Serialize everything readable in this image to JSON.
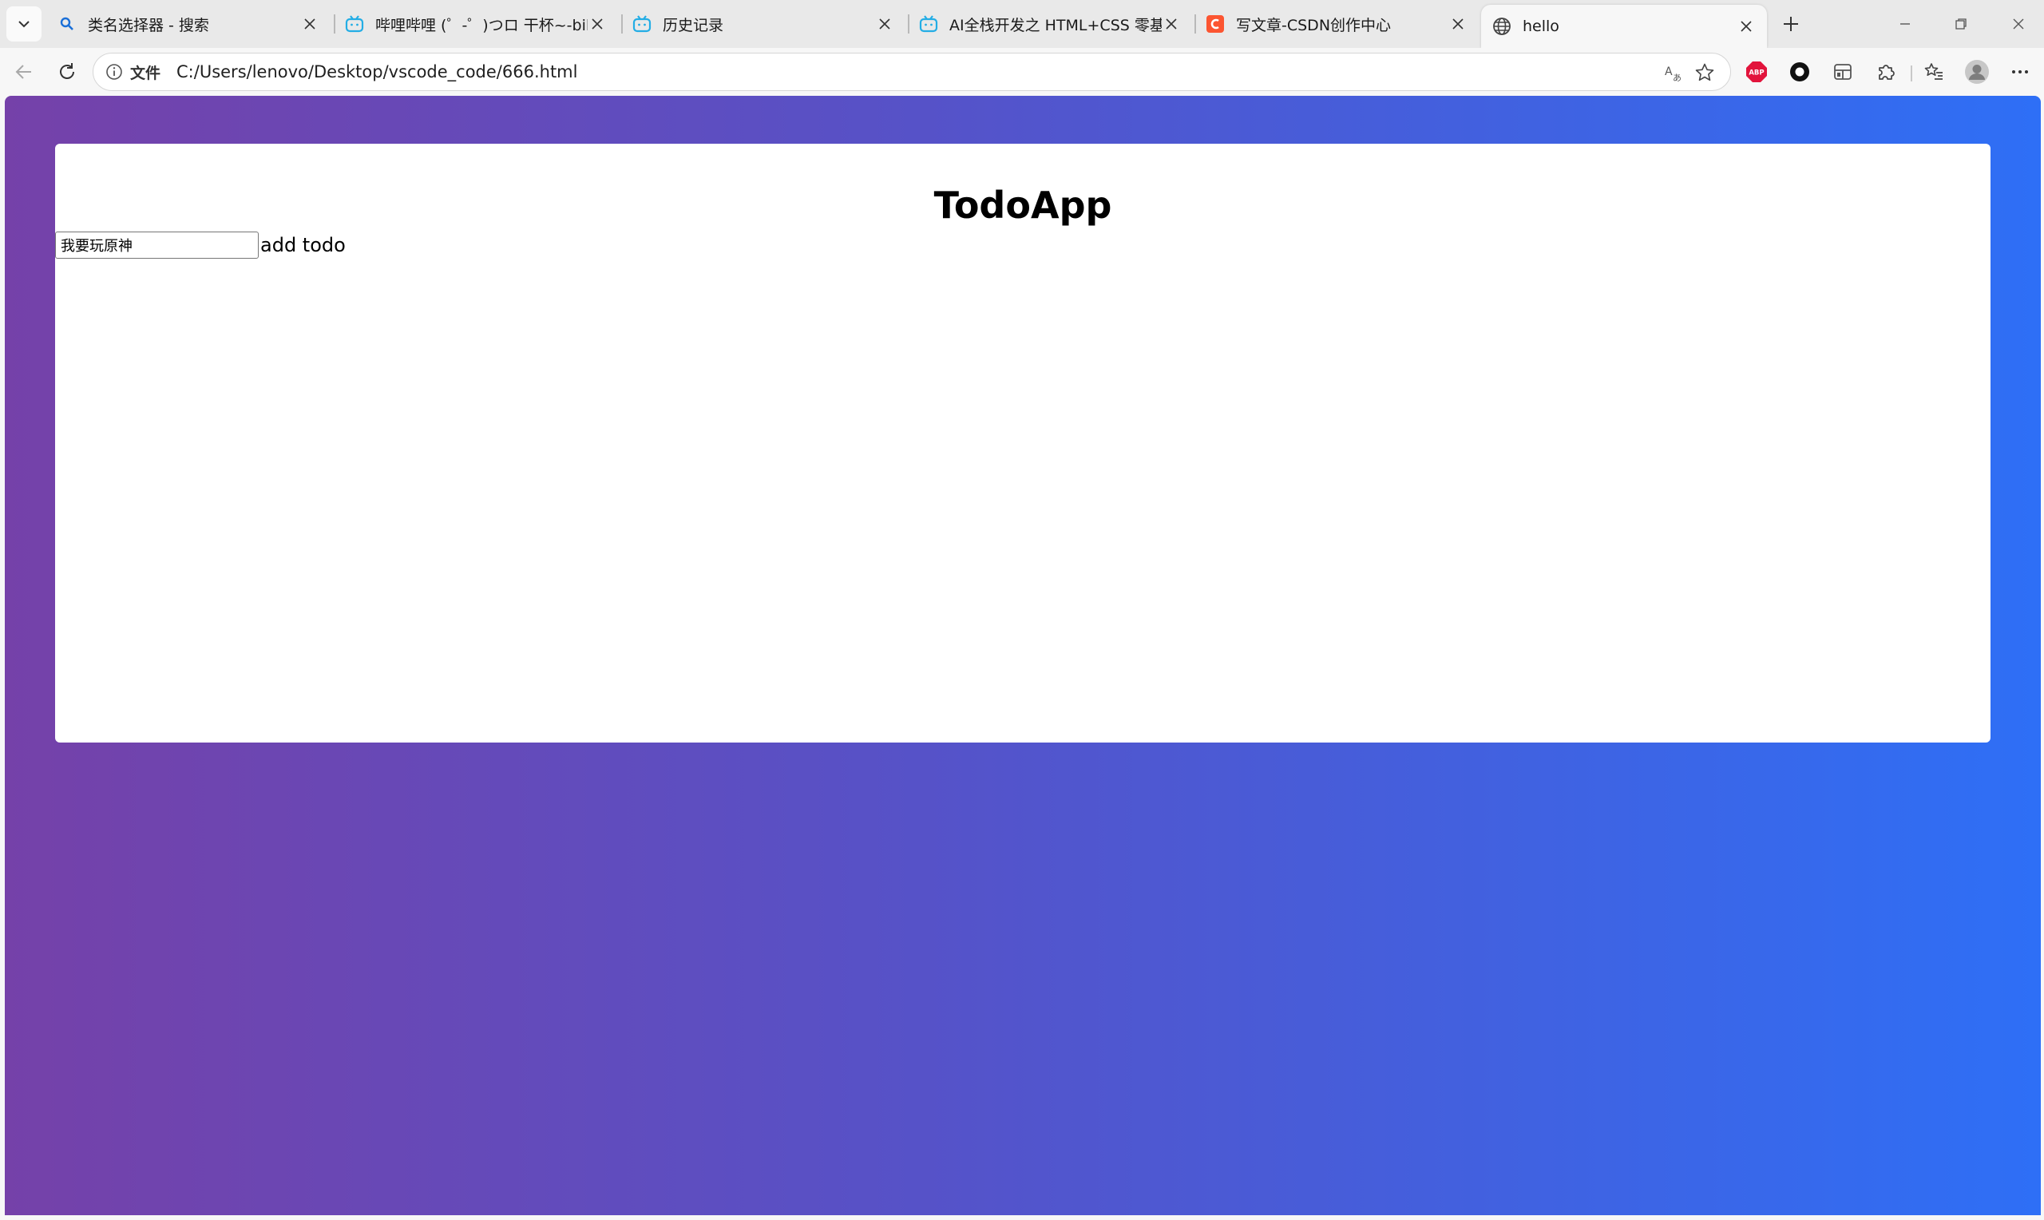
{
  "browser": {
    "tabs": [
      {
        "title": "类名选择器 - 搜索",
        "icon": "search-icon"
      },
      {
        "title": "哔哩哔哩 (゜-゜)つロ 干杯~-bilibili",
        "icon": "bilibili-icon"
      },
      {
        "title": "历史记录",
        "icon": "bilibili-icon"
      },
      {
        "title": "AI全栈开发之 HTML+CSS 零基础入门",
        "icon": "bilibili-icon"
      },
      {
        "title": "写文章-CSDN创作中心",
        "icon": "csdn-icon"
      },
      {
        "title": "hello",
        "icon": "globe-icon"
      }
    ],
    "active_tab_index": 5,
    "address": {
      "label": "文件",
      "url": "C:/Users/lenovo/Desktop/vscode_code/666.html"
    },
    "colors": {
      "gradient_start": "#7541a9",
      "gradient_end": "#2e6ff6",
      "bilibili": "#23ade5",
      "csdn": "#fc5531",
      "abp": "#e2143c"
    }
  },
  "page": {
    "heading": "TodoApp",
    "todo_input_value": "我要玩原神",
    "add_button_label": "add todo"
  }
}
